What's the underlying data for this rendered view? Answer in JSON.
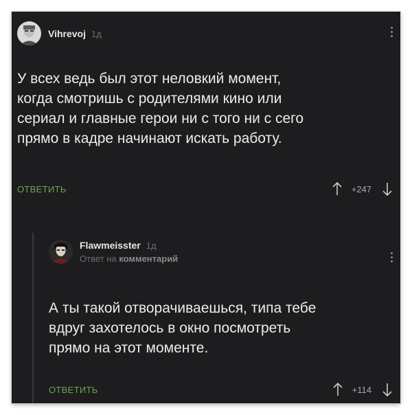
{
  "comments": [
    {
      "username": "Vihrevoj",
      "time": "1д",
      "text": "У всех ведь был этот неловкий момент,\nкогда смотришь с родителями кино или\nсериал и главные герои ни с того ни с сего\nпрямо в кадре начинают искать работу.",
      "reply_label": "ОТВЕТИТЬ",
      "score": "+247"
    },
    {
      "username": "Flawmeisster",
      "time": "1д",
      "reply_prefix": "Ответ на",
      "reply_link": "комментарий",
      "text": "А ты такой отворачиваешься, типа тебе\nвдруг захотелось в окно посмотреть\nпрямо на этот моменте.",
      "reply_label": "ОТВЕТИТЬ",
      "score": "+114"
    }
  ],
  "colors": {
    "background": "#1d1d1f",
    "text": "#ececec",
    "accent_green": "#6aa84f",
    "muted": "#6d6d6f"
  },
  "icons": [
    "avatar",
    "kebab-menu-icon",
    "upvote-arrow-icon",
    "downvote-arrow-icon"
  ]
}
